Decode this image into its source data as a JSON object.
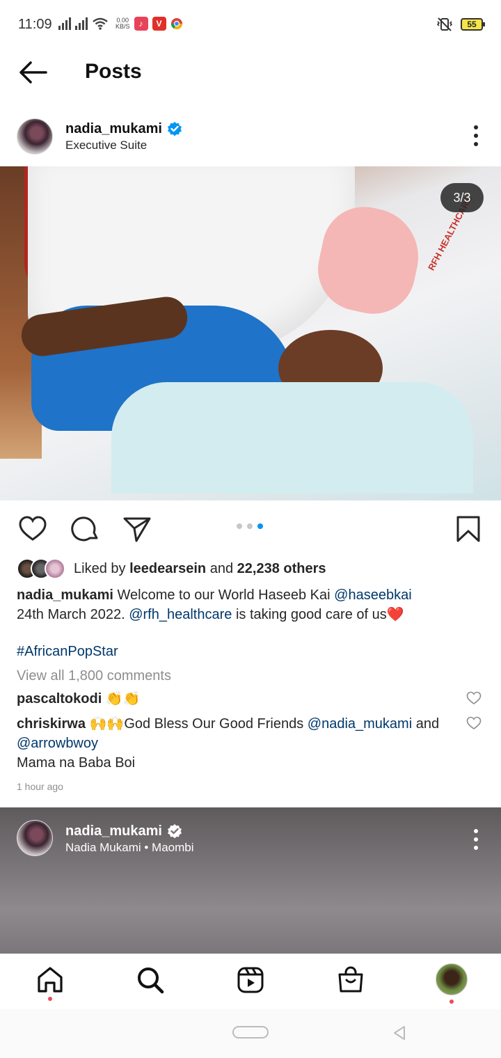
{
  "status_bar": {
    "time": "11:09",
    "net_speed_value": "0.00",
    "net_speed_unit": "KB/S",
    "battery": "55",
    "icons": [
      "signal-icon",
      "signal-icon",
      "wifi-icon",
      "music-app-icon",
      "vpn-app-icon",
      "chrome-icon",
      "vibrate-icon",
      "battery-icon"
    ]
  },
  "header": {
    "title": "Posts",
    "back_icon": "arrow-left-icon"
  },
  "post": {
    "username": "nadia_mukami",
    "location": "Executive Suite",
    "verified": true,
    "carousel_counter": "3/3",
    "photo_brand_text": "RFH HEALTHCARE",
    "carousel_total": 3,
    "carousel_active": 3,
    "likes": {
      "prefix": "Liked by",
      "user": "leedearsein",
      "connector": "and",
      "count": "22,238 others"
    },
    "caption": {
      "author": "nadia_mukami",
      "text1": "Welcome to our World Haseeb Kai",
      "mention1": "@haseebkai",
      "text2": "24th March 2022.",
      "mention2": "@rfh_healthcare",
      "text3": "is taking good care of us❤️",
      "hashtag": "#AfricanPopStar"
    },
    "view_all": "View all 1,800 comments",
    "comments": [
      {
        "user": "pascaltokodi",
        "text": "👏👏"
      },
      {
        "user": "chriskirwa",
        "text": "🙌🙌God Bless Our Good Friends",
        "mention1": "@nadia_mukami",
        "and": "and",
        "mention2": "@arrowbwoy",
        "line2": "Mama na Baba Boi"
      }
    ],
    "timestamp": "1 hour ago"
  },
  "next_post": {
    "username": "nadia_mukami",
    "subtitle": "Nadia Mukami • Maombi"
  },
  "bottom_nav": {
    "items": [
      "home-icon",
      "search-icon",
      "reels-icon",
      "shop-icon",
      "profile-avatar"
    ]
  },
  "colors": {
    "link": "#00376b",
    "verified": "#0095f6",
    "carousel_active_dot": "#0095f6",
    "notification_dot": "#ed4956"
  }
}
